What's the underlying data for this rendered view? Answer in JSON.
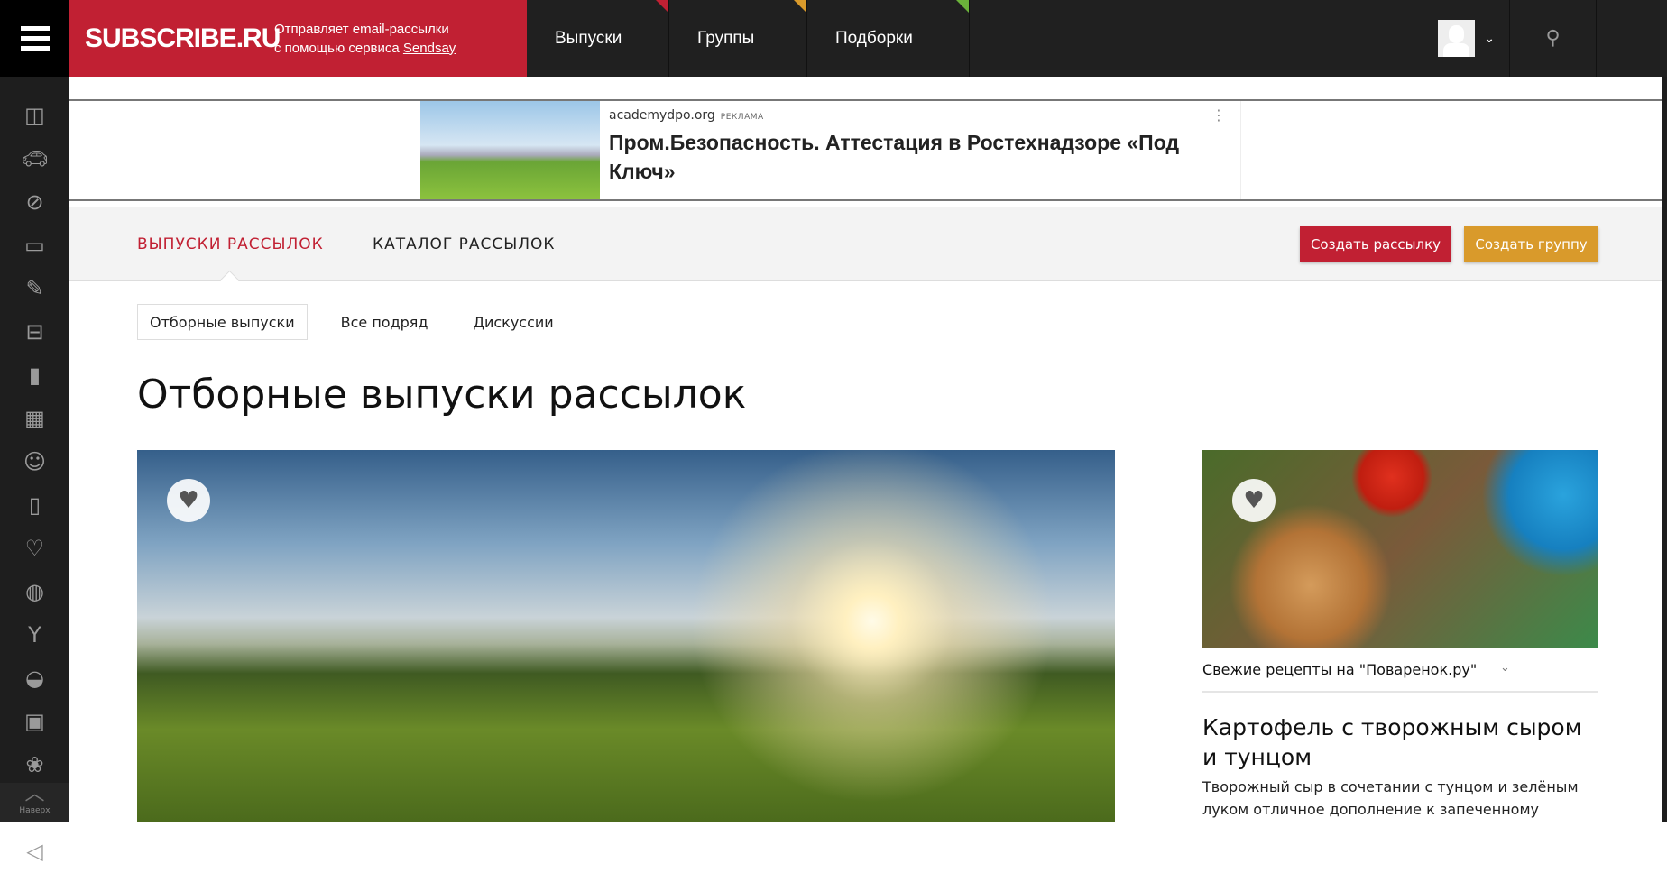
{
  "header": {
    "logo": "SUBSCRIBE.RU",
    "tagline_line1": "Отправляет email-рассылки",
    "tagline_line2": "с помощью сервиса ",
    "tagline_link": "Sendsay",
    "nav": [
      {
        "label": "Выпуски",
        "color": "#c12033"
      },
      {
        "label": "Группы",
        "color": "#d99a2b"
      },
      {
        "label": "Подборки",
        "color": "#6bb33a"
      }
    ]
  },
  "sidebar": {
    "icons": [
      "layout-icon",
      "car-icon",
      "compass-icon",
      "monitor-icon",
      "brush-icon",
      "briefcase-icon",
      "chart-bars-icon",
      "building-icon",
      "baby-icon",
      "phone-icon",
      "heart-icon",
      "basketball-icon",
      "cocktail-icon",
      "food-icon",
      "camera-icon",
      "paw-icon",
      "home-icon",
      "megaphone-icon"
    ],
    "to_top": "Наверх"
  },
  "ad": {
    "source": "academydpo.org",
    "label": "РЕКЛАМА",
    "title": "Пром.Безопасность. Аттестация в Ростехнадзоре «Под Ключ»"
  },
  "tabs": {
    "issues": "ВЫПУСКИ РАССЫЛОК",
    "catalog": "КАТАЛОГ РАССЫЛОК",
    "create_mailing": "Создать рассылку",
    "create_group": "Создать группу"
  },
  "subtabs": [
    "Отборные выпуски",
    "Все подряд",
    "Дискуссии"
  ],
  "page_title": "Отборные выпуски рассылок",
  "side_article": {
    "feed": "Свежие рецепты на \"Поваренок.ру\"",
    "title": "Картофель с творожным сыром и тунцом",
    "desc": "Творожный сыр в сочетании с тунцом и зелёным луком отличное дополнение к запеченному"
  },
  "colors": {
    "brand": "#c12033",
    "accent": "#d99a2b"
  }
}
